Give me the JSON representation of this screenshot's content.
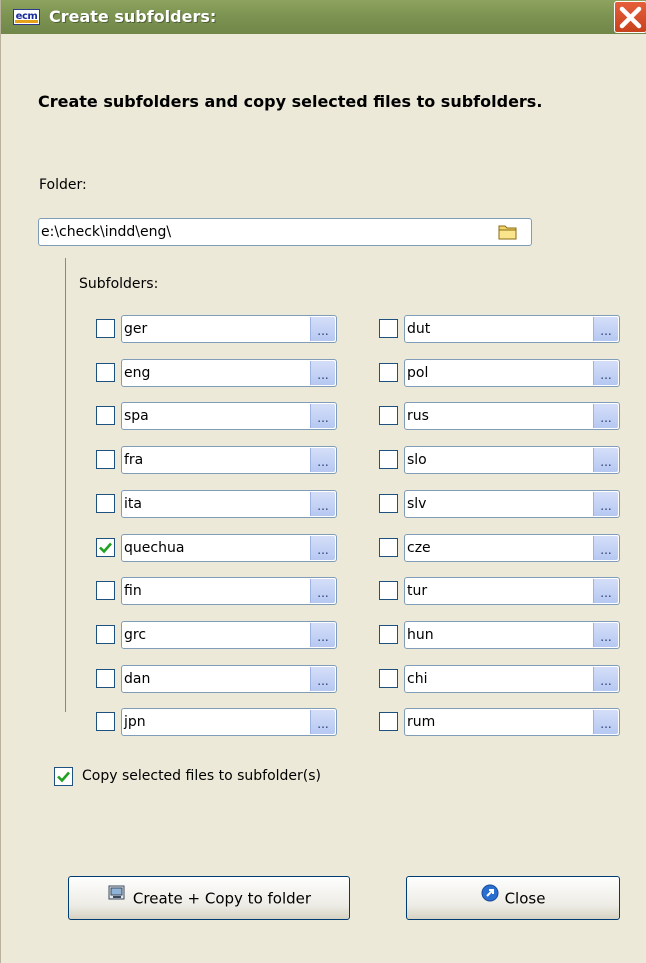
{
  "window": {
    "title": "Create subfolders:",
    "logo_text": "ecm"
  },
  "heading": "Create subfolders and copy selected files to subfolders.",
  "folder": {
    "label": "Folder:",
    "value": "e:\\check\\indd\\eng\\"
  },
  "subfolders": {
    "label": "Subfolders:",
    "browse_label": "...",
    "left": [
      {
        "value": "ger",
        "checked": false
      },
      {
        "value": "eng",
        "checked": false
      },
      {
        "value": "spa",
        "checked": false
      },
      {
        "value": "fra",
        "checked": false
      },
      {
        "value": "ita",
        "checked": false
      },
      {
        "value": "quechua",
        "checked": true
      },
      {
        "value": "fin",
        "checked": false
      },
      {
        "value": "grc",
        "checked": false
      },
      {
        "value": "dan",
        "checked": false
      },
      {
        "value": "jpn",
        "checked": false
      }
    ],
    "right": [
      {
        "value": "dut",
        "checked": false
      },
      {
        "value": "pol",
        "checked": false
      },
      {
        "value": "rus",
        "checked": false
      },
      {
        "value": "slo",
        "checked": false
      },
      {
        "value": "slv",
        "checked": false
      },
      {
        "value": "cze",
        "checked": false
      },
      {
        "value": "tur",
        "checked": false
      },
      {
        "value": "hun",
        "checked": false
      },
      {
        "value": "chi",
        "checked": false
      },
      {
        "value": "rum",
        "checked": false
      }
    ]
  },
  "copy_files": {
    "label": "Copy selected files to subfolder(s)",
    "checked": true
  },
  "buttons": {
    "create_copy": "Create + Copy to folder",
    "close": "Close"
  },
  "colors": {
    "titlebar": "#7d9352",
    "window_bg": "#ece9d8",
    "check_green": "#21a121"
  }
}
